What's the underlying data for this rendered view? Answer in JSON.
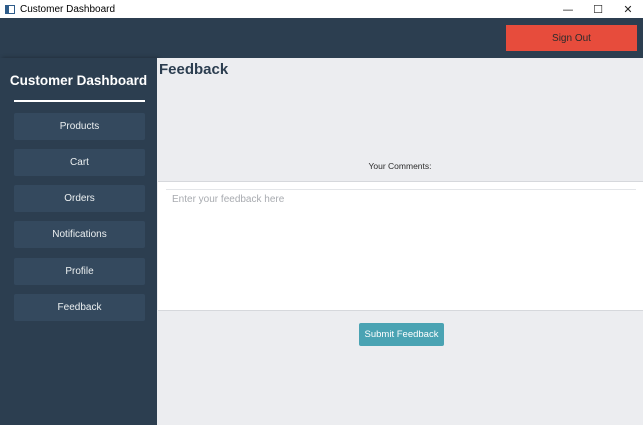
{
  "window": {
    "title": "Customer Dashboard",
    "minimize": "—",
    "maximize": "☐",
    "close": "✕"
  },
  "header": {
    "sign_out_label": "Sign Out",
    "sign_out_color": "#e74c3c"
  },
  "sidebar": {
    "title": "Customer Dashboard",
    "items": [
      {
        "label": "Products"
      },
      {
        "label": "Cart"
      },
      {
        "label": "Orders"
      },
      {
        "label": "Notifications"
      },
      {
        "label": "Profile"
      },
      {
        "label": "Feedback"
      }
    ]
  },
  "main": {
    "title": "Feedback",
    "comments_label": "Your Comments:",
    "feedback_placeholder": "Enter your feedback here",
    "submit_label": "Submit Feedback",
    "submit_color": "#4aa3b3"
  },
  "colors": {
    "sidebar_bg": "#2c3e50",
    "nav_item_bg": "#34495e",
    "main_bg": "#ecedf0"
  }
}
